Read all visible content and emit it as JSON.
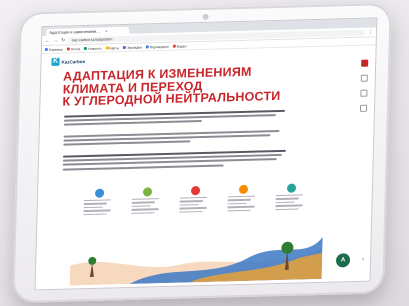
{
  "browser": {
    "tab_title": "Адаптация к изменениям…",
    "tab_close": "×",
    "address": "kaz-carbon.kz/adaptation",
    "back_icon": "arrow-left-icon",
    "forward_icon": "arrow-right-icon",
    "reload_icon": "reload-icon",
    "bookmarks": [
      {
        "label": "Сервисы",
        "color": "#4285f4"
      },
      {
        "label": "Почта",
        "color": "#db4437"
      },
      {
        "label": "Новости",
        "color": "#0f9d58"
      },
      {
        "label": "Карты",
        "color": "#f4b400"
      },
      {
        "label": "Закладки",
        "color": "#7e57c2"
      },
      {
        "label": "Переводчик",
        "color": "#4285f4"
      },
      {
        "label": "Видео",
        "color": "#db4437"
      }
    ]
  },
  "site": {
    "logo_letter": "K",
    "logo_text": "KazCarbon",
    "title_lines": [
      "АДАПТАЦИЯ К ИЗМЕНЕНИЯМ",
      "КЛИМАТА И ПЕРЕХОД",
      "К УГЛЕРОДНОЙ НЕЙТРАЛЬНОСТИ"
    ],
    "accent_color": "#c7262c",
    "fab_label": "A"
  },
  "infographic": {
    "steps": [
      {
        "color": "#3a8fd6"
      },
      {
        "color": "#7cb342"
      },
      {
        "color": "#e53935"
      },
      {
        "color": "#fb8c00"
      },
      {
        "color": "#26a69a"
      }
    ]
  }
}
